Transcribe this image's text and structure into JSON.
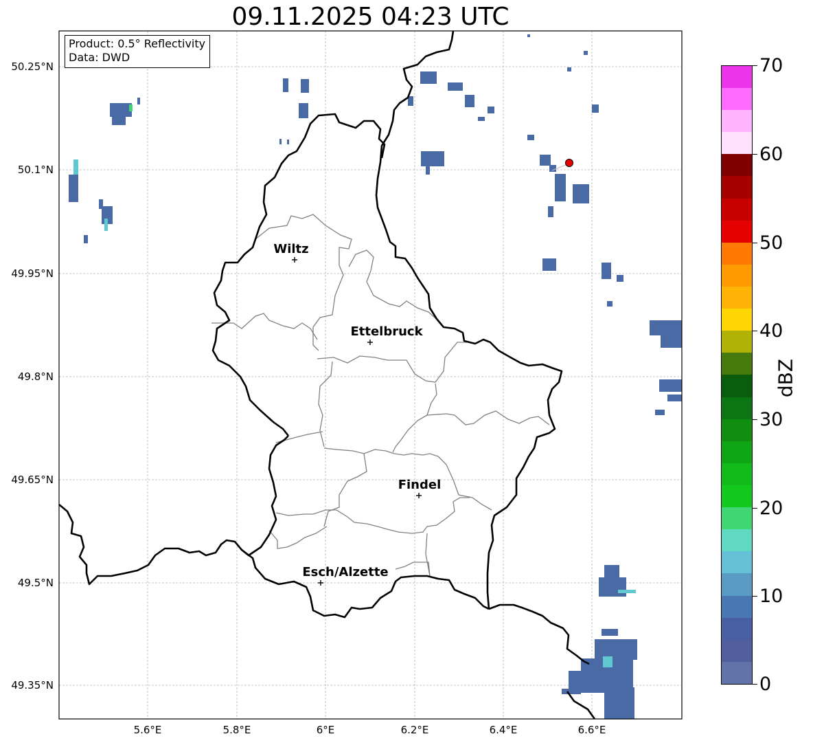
{
  "title": "09.11.2025 04:23 UTC",
  "info": {
    "product": "Product: 0.5° Reflectivity",
    "data": "Data: DWD"
  },
  "x_ticks": [
    "5.6°E",
    "5.8°E",
    "6°E",
    "6.2°E",
    "6.4°E",
    "6.6°E"
  ],
  "y_ticks": [
    "50.25°N",
    "50.1°N",
    "49.95°N",
    "49.8°N",
    "49.65°N",
    "49.5°N",
    "49.35°N"
  ],
  "cities": [
    "Wiltz",
    "Ettelbruck",
    "Findel",
    "Esch/Alzette"
  ],
  "colorbar": {
    "label": "dBZ",
    "ticks": [
      "0",
      "10",
      "20",
      "30",
      "40",
      "50",
      "60",
      "70"
    ],
    "colors": [
      "#6173a8",
      "#525f9d",
      "#4860a3",
      "#4a78b2",
      "#5a9bc4",
      "#65c0d8",
      "#60d9c3",
      "#3fd674",
      "#13c91d",
      "#13bb1a",
      "#10a515",
      "#0f8e12",
      "#0c7612",
      "#0a5d0d",
      "#467a0c",
      "#b0b303",
      "#fed702",
      "#ffb304",
      "#ff9a00",
      "#ff7a00",
      "#e60000",
      "#c80000",
      "#a60000",
      "#7f0000",
      "#ffe1ff",
      "#ffb4ff",
      "#ff6aff",
      "#ea35ea"
    ]
  },
  "colors": {
    "border": "#000000",
    "canton": "#808080",
    "radar_site": "#e60000"
  }
}
